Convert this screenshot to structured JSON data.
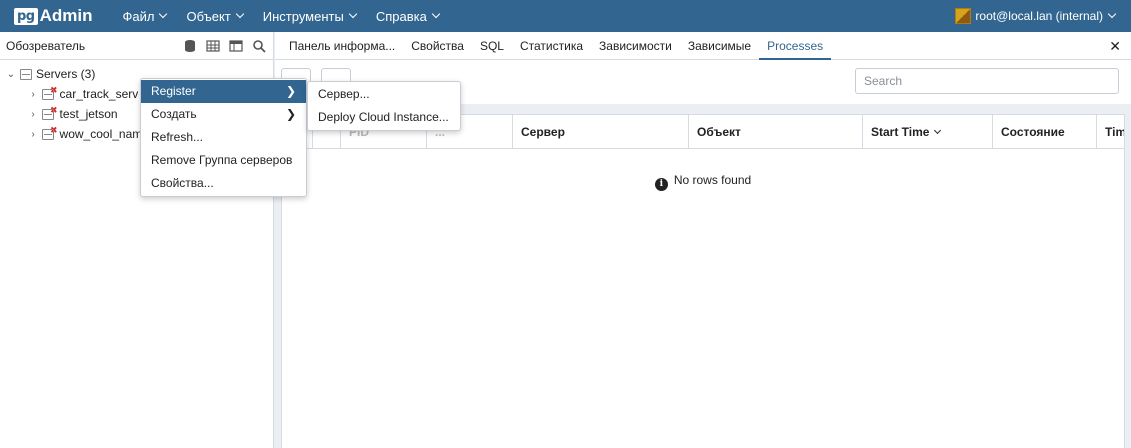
{
  "navbar": {
    "logo_pg": "pg",
    "logo_admin": "Admin",
    "menu": [
      "Файл",
      "Объект",
      "Инструменты",
      "Справка"
    ],
    "user": "root@local.lan (internal)"
  },
  "browser": {
    "title": "Обозреватель",
    "tree": {
      "root": "Servers (3)",
      "children": [
        "car_track_serv",
        "test_jetson",
        "wow_cool_nam"
      ]
    }
  },
  "tabs": [
    "Панель информа...",
    "Свойства",
    "SQL",
    "Статистика",
    "Зависимости",
    "Зависимые",
    "Processes"
  ],
  "active_tab": "Processes",
  "search": {
    "placeholder": "Search"
  },
  "table": {
    "columns": [
      "",
      "",
      "",
      "PID",
      "...",
      "Сервер",
      "Объект",
      "Start Time",
      "Состояние",
      "Tim"
    ],
    "empty_message": "No rows found"
  },
  "context_menu": {
    "items": [
      "Register",
      "Создать",
      "Refresh...",
      "Remove Группа серверов",
      "Свойства..."
    ],
    "submenu": [
      "Сервер...",
      "Deploy Cloud Instance..."
    ]
  },
  "colors": {
    "brand": "#326690",
    "error": "#d92424"
  }
}
